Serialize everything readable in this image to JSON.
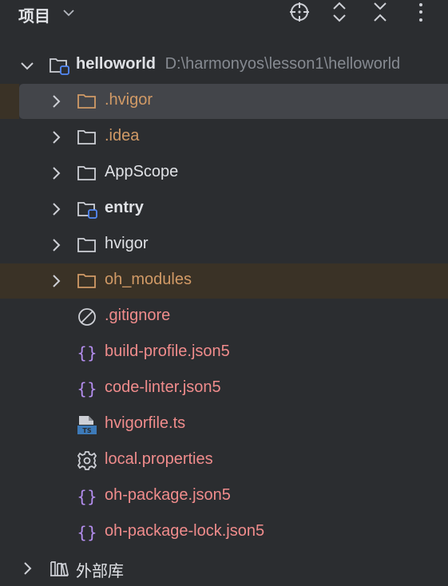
{
  "header": {
    "title": "项目",
    "icons": [
      "chevron-down-icon",
      "locate-icon",
      "expand-all-icon",
      "collapse-all-icon",
      "more-options-icon"
    ]
  },
  "tree": {
    "root": {
      "name": "helloworld",
      "path": "D:\\harmonyos\\lesson1\\helloworld"
    },
    "items": [
      {
        "label": ".hvigor",
        "icon": "folder-excluded-icon",
        "state": "selected"
      },
      {
        "label": ".idea",
        "icon": "folder-icon"
      },
      {
        "label": "AppScope",
        "icon": "folder-icon"
      },
      {
        "label": "entry",
        "icon": "module-folder-icon"
      },
      {
        "label": "hvigor",
        "icon": "folder-icon"
      },
      {
        "label": "oh_modules",
        "icon": "folder-excluded-icon"
      },
      {
        "label": ".gitignore",
        "icon": "ignore-file-icon"
      },
      {
        "label": "build-profile.json5",
        "icon": "json-icon"
      },
      {
        "label": "code-linter.json5",
        "icon": "json-icon"
      },
      {
        "label": "hvigorfile.ts",
        "icon": "typescript-icon"
      },
      {
        "label": "local.properties",
        "icon": "gear-icon"
      },
      {
        "label": "oh-package.json5",
        "icon": "json-icon"
      },
      {
        "label": "oh-package-lock.json5",
        "icon": "json-icon"
      }
    ],
    "external": {
      "label": "外部库",
      "icon": "library-icon"
    }
  },
  "colors": {
    "background": "#2b2d30",
    "selected_row": "#43454a",
    "excluded_row": "#3a3226",
    "excluded_text": "#d19a66",
    "file_text": "#f08c8c",
    "json_icon": "#b58ef0"
  }
}
